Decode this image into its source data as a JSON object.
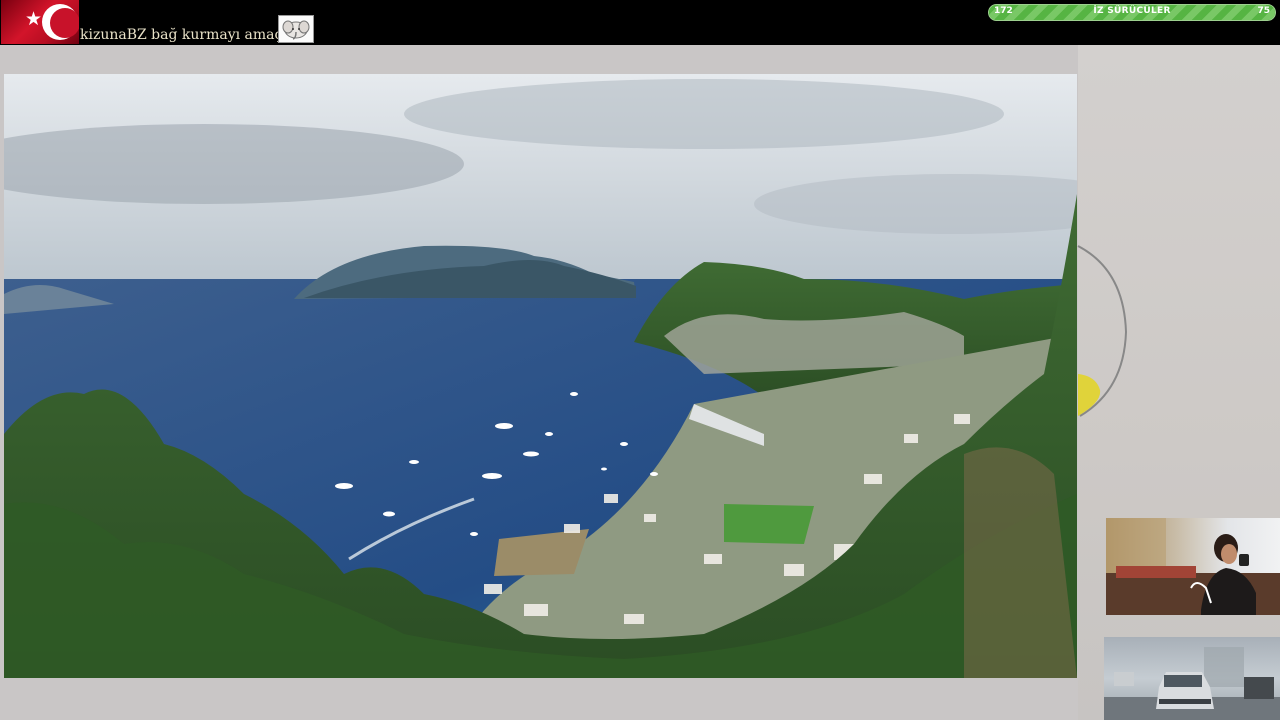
{
  "topbar": {
    "status_text": "kizunaBZ bağ kurmayı amaçlar",
    "flag_icon": "turkey-flag-icon",
    "sticker_icon": "elephant-sticker-icon"
  },
  "progress": {
    "left_value": "172",
    "label": "İZ SÜRÜCÜLER",
    "right_value": "75",
    "fill_fraction": 1.0,
    "color": "#3f9a31"
  },
  "main_image": {
    "subject": "coastal-harbor-landscape"
  },
  "webcams": {
    "cam1_icon": "webcam-person-icon",
    "cam2_icon": "webcam-street-car-icon"
  },
  "colors": {
    "topbar_bg": "#000000",
    "page_bg": "#c9c6c6",
    "progress_green": "#3f9a31"
  }
}
